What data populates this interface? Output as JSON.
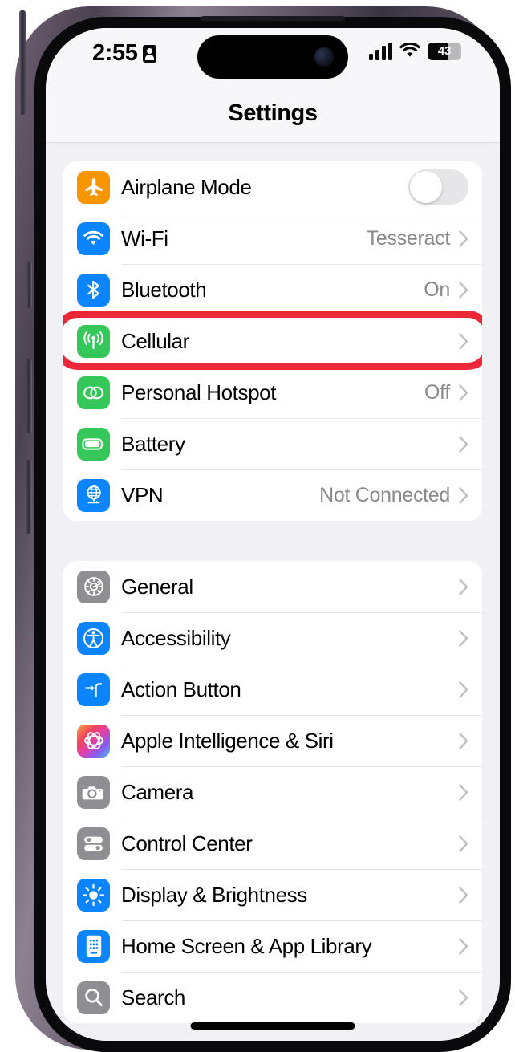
{
  "status_bar": {
    "time": "2:55",
    "id_icon": "contact-card-icon",
    "cellular_icon": "cellular-bars-icon",
    "wifi_icon": "wifi-icon",
    "battery_percent": "43",
    "battery_fill_ratio": 0.62
  },
  "nav": {
    "title": "Settings"
  },
  "colors": {
    "highlight": "#ed2738",
    "accent_blue": "#0a84ff",
    "green": "#34c759",
    "orange": "#f79500",
    "gray": "#8e8e93"
  },
  "annotation": {
    "target_row": "Cellular",
    "shape": "rounded-rectangle",
    "color": "#ed2738"
  },
  "groups": [
    {
      "id": "connectivity",
      "rows": [
        {
          "label": "Airplane Mode",
          "icon": "airplane-icon",
          "icon_color": "#f79500",
          "control": "toggle",
          "toggle_on": false
        },
        {
          "label": "Wi-Fi",
          "icon": "wifi-icon",
          "icon_color": "#0a84ff",
          "value": "Tesseract",
          "control": "chevron"
        },
        {
          "label": "Bluetooth",
          "icon": "bluetooth-icon",
          "icon_color": "#0a84ff",
          "value": "On",
          "control": "chevron"
        },
        {
          "label": "Cellular",
          "icon": "cellular-antenna-icon",
          "icon_color": "#34c759",
          "value": "",
          "control": "chevron",
          "highlighted": true
        },
        {
          "label": "Personal Hotspot",
          "icon": "hotspot-links-icon",
          "icon_color": "#34c759",
          "value": "Off",
          "control": "chevron"
        },
        {
          "label": "Battery",
          "icon": "battery-icon",
          "icon_color": "#34c759",
          "value": "",
          "control": "chevron"
        },
        {
          "label": "VPN",
          "icon": "vpn-globe-icon",
          "icon_color": "#0a84ff",
          "value": "Not Connected",
          "control": "chevron"
        }
      ]
    },
    {
      "id": "system",
      "rows": [
        {
          "label": "General",
          "icon": "gear-icon",
          "icon_color": "#8e8e93",
          "value": "",
          "control": "chevron"
        },
        {
          "label": "Accessibility",
          "icon": "accessibility-icon",
          "icon_color": "#0a84ff",
          "value": "",
          "control": "chevron"
        },
        {
          "label": "Action Button",
          "icon": "action-button-icon",
          "icon_color": "#0a84ff",
          "value": "",
          "control": "chevron"
        },
        {
          "label": "Apple Intelligence & Siri",
          "icon": "apple-intelligence-icon",
          "icon_color": "gradient",
          "value": "",
          "control": "chevron"
        },
        {
          "label": "Camera",
          "icon": "camera-icon",
          "icon_color": "#8e8e93",
          "value": "",
          "control": "chevron"
        },
        {
          "label": "Control Center",
          "icon": "control-center-icon",
          "icon_color": "#8e8e93",
          "value": "",
          "control": "chevron"
        },
        {
          "label": "Display & Brightness",
          "icon": "brightness-icon",
          "icon_color": "#0a84ff",
          "value": "",
          "control": "chevron"
        },
        {
          "label": "Home Screen & App Library",
          "icon": "home-screen-icon",
          "icon_color": "#0a84ff",
          "value": "",
          "control": "chevron"
        },
        {
          "label": "Search",
          "icon": "search-icon",
          "icon_color": "#8e8e93",
          "value": "",
          "control": "chevron"
        }
      ]
    }
  ]
}
